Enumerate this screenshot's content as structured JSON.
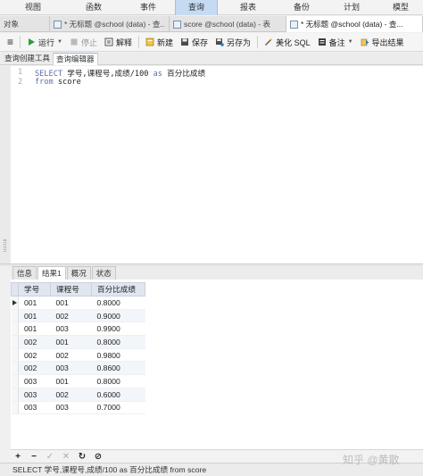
{
  "menu": {
    "items": [
      {
        "label": "视图",
        "w": 74
      },
      {
        "label": "函数",
        "w": 62
      },
      {
        "label": "事件",
        "w": 60
      },
      {
        "label": "查询",
        "w": 48,
        "active": true
      },
      {
        "label": "报表",
        "w": 68
      },
      {
        "label": "备份",
        "w": 52
      },
      {
        "label": "计划",
        "w": 60
      },
      {
        "label": "模型",
        "w": 50
      }
    ]
  },
  "tabs": {
    "items": [
      {
        "label": "对象",
        "icon": false,
        "w": 56
      },
      {
        "label": "* 无标题 @school (data) - 查...",
        "icon": true,
        "w": 134
      },
      {
        "label": "score @school (data) - 表",
        "icon": true,
        "w": 131
      },
      {
        "label": "* 无标题 @school (data) - 查...",
        "icon": true,
        "w": 153,
        "active": true
      }
    ]
  },
  "toolbar": {
    "menu_label": "≡",
    "run": "运行",
    "stop": "停止",
    "explain": "解释",
    "new": "新建",
    "save": "保存",
    "save_as": "另存为",
    "beautify": "美化 SQL",
    "comment": "备注",
    "export": "导出结果"
  },
  "subtabs": {
    "builder": "查询创建工具",
    "editor": "查询编辑器"
  },
  "editor": {
    "lines": [
      {
        "num": "1",
        "parts": [
          {
            "t": "SELECT",
            "kw": true
          },
          {
            "t": " 学号,课程号,成绩/100 ",
            "kw": false
          },
          {
            "t": "as",
            "kw": true
          },
          {
            "t": " 百分比成绩",
            "kw": false
          }
        ]
      },
      {
        "num": "2",
        "parts": [
          {
            "t": "from",
            "kw": true
          },
          {
            "t": " score",
            "kw": false
          }
        ]
      }
    ]
  },
  "result_tabs": {
    "info": "信息",
    "result1": "结果1",
    "profile": "概况",
    "status": "状态"
  },
  "grid": {
    "columns": [
      "学号",
      "课程号",
      "百分比成绩"
    ],
    "rows": [
      [
        "001",
        "001",
        "0.8000"
      ],
      [
        "001",
        "002",
        "0.9000"
      ],
      [
        "001",
        "003",
        "0.9900"
      ],
      [
        "002",
        "001",
        "0.8000"
      ],
      [
        "002",
        "002",
        "0.9800"
      ],
      [
        "002",
        "003",
        "0.8600"
      ],
      [
        "003",
        "001",
        "0.8000"
      ],
      [
        "003",
        "002",
        "0.6000"
      ],
      [
        "003",
        "003",
        "0.7000"
      ]
    ]
  },
  "bottom_buttons": [
    "+",
    "−",
    "✓",
    "✕",
    "↻",
    "⊘"
  ],
  "status": {
    "text": "SELECT 学号,课程号,成绩/100 as 百分比成绩  from score"
  },
  "watermark": "知乎 @黄散"
}
